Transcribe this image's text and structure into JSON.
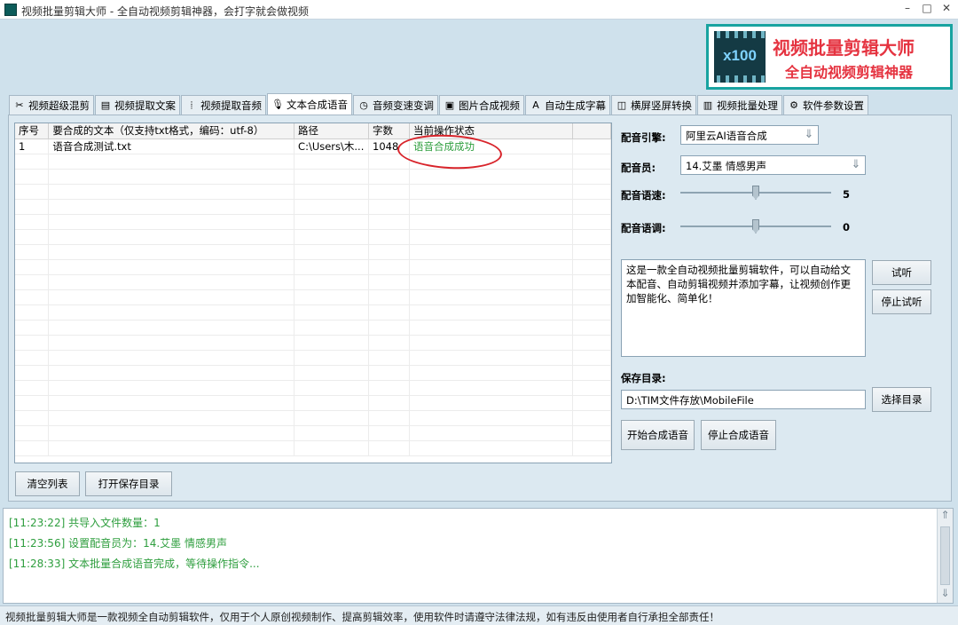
{
  "window": {
    "title": "视频批量剪辑大师 - 全自动视频剪辑神器，会打字就会做视频",
    "controls": [
      "–",
      "□",
      "✕"
    ]
  },
  "banner": {
    "badge": "x100",
    "line1": "视频批量剪辑大师",
    "line2": "全自动视频剪辑神器"
  },
  "tabs": [
    {
      "label": "视频超级混剪",
      "icon": "✂"
    },
    {
      "label": "视频提取文案",
      "icon": "▤"
    },
    {
      "label": "视频提取音频",
      "icon": "⦙"
    },
    {
      "label": "文本合成语音",
      "icon": "🎙"
    },
    {
      "label": "音频变速变调",
      "icon": "◷"
    },
    {
      "label": "图片合成视频",
      "icon": "▣"
    },
    {
      "label": "自动生成字幕",
      "icon": "A"
    },
    {
      "label": "横屏竖屏转换",
      "icon": "◫"
    },
    {
      "label": "视频批量处理",
      "icon": "▥"
    },
    {
      "label": "软件参数设置",
      "icon": "⚙"
    }
  ],
  "active_tab": 3,
  "table": {
    "columns": [
      "序号",
      "要合成的文本（仅支持txt格式，编码：utf-8）",
      "路径",
      "字数",
      "当前操作状态"
    ],
    "rows": [
      [
        "1",
        "语音合成测试.txt",
        "C:\\Users\\木...",
        "1048",
        "语音合成成功"
      ]
    ]
  },
  "settings": {
    "engine_label": "配音引擎:",
    "engine_value": "阿里云AI语音合成",
    "voice_label": "配音员:",
    "voice_value": "14.艾墨 情感男声",
    "speed_label": "配音语速:",
    "speed_value": "5",
    "speed_fraction": 0.5,
    "pitch_label": "配音语调:",
    "pitch_value": "0",
    "pitch_fraction": 0.5,
    "preview_text": "这是一款全自动视频批量剪辑软件，可以自动给文本配音、自动剪辑视频并添加字幕，让视频创作更加智能化、简单化！",
    "audition_button": "试听",
    "stop_audition_button": "停止试听",
    "save_dir_label": "保存目录:",
    "save_dir_value": "D:\\TIM文件存放\\MobileFile",
    "choose_dir_button": "选择目录",
    "start_button": "开始合成语音",
    "stop_button": "停止合成语音"
  },
  "list_buttons": {
    "clear": "清空列表",
    "open_dir": "打开保存目录"
  },
  "log": [
    "[11:23:22] 共导入文件数量：1",
    "[11:23:56] 设置配音员为：14.艾墨 情感男声",
    "[11:28:33] 文本批量合成语音完成，等待操作指令..."
  ],
  "status_bar": "视频批量剪辑大师是一款视频全自动剪辑软件，仅用于个人原创视频制作、提高剪辑效率，使用软件时请遵守法律法规，如有违反由使用者自行承担全部责任！",
  "colors": {
    "success": "#2e9e3e",
    "banner_red": "#e53340",
    "banner_border": "#18a3a0",
    "annotation_ring": "#d8232a"
  }
}
